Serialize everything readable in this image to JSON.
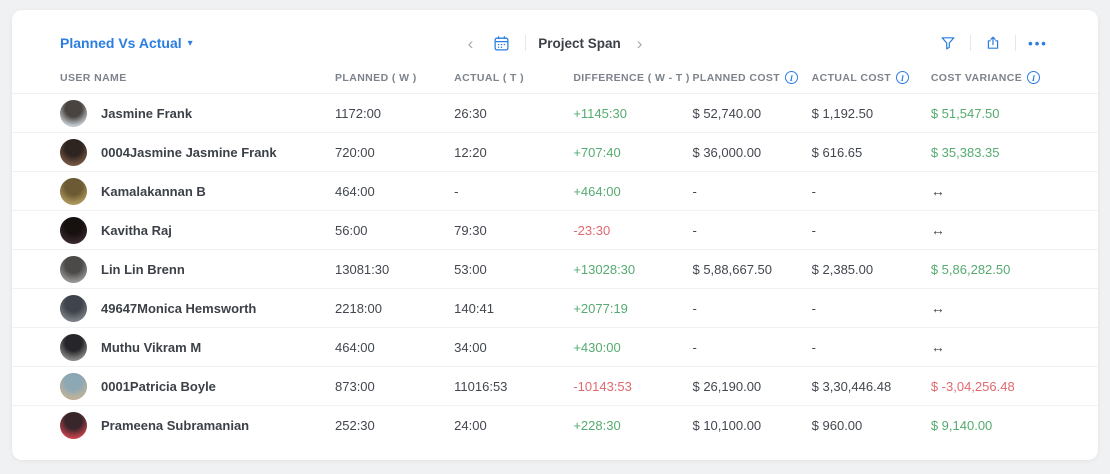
{
  "accent": {
    "blue": "#2b7de0",
    "green": "#55ab70",
    "red": "#e0696f",
    "card_bg": "#ffffff",
    "page_bg": "#f0f1f2"
  },
  "toolbar": {
    "view_selector_label": "Planned Vs Actual",
    "caret": "▾",
    "prev_glyph": "‹",
    "next_glyph": "›",
    "period_label": "Project Span",
    "more_glyph": "•••"
  },
  "table": {
    "columns": [
      {
        "label": "USER NAME",
        "info": false
      },
      {
        "label": "PLANNED ( W )",
        "info": false
      },
      {
        "label": "ACTUAL ( T )",
        "info": false
      },
      {
        "label": "DIFFERENCE ( W - T )",
        "info": false
      },
      {
        "label": "PLANNED COST",
        "info": true
      },
      {
        "label": "ACTUAL COST",
        "info": true
      },
      {
        "label": "COST VARIANCE",
        "info": true
      }
    ],
    "rows": [
      {
        "name": "Jasmine Frank",
        "planned": "1172:00",
        "actual": "26:30",
        "difference": "+1145:30",
        "difference_color": "green",
        "planned_cost": "$ 52,740.00",
        "actual_cost": "$ 1,192.50",
        "cost_variance": "$ 51,547.50",
        "variance_color": "green",
        "avatar": [
          "#cdd5dc",
          "#4a4440"
        ]
      },
      {
        "name": "0004Jasmine Jasmine Frank",
        "planned": "720:00",
        "actual": "12:20",
        "difference": "+707:40",
        "difference_color": "green",
        "planned_cost": "$ 36,000.00",
        "actual_cost": "$ 616.65",
        "cost_variance": "$ 35,383.35",
        "variance_color": "green",
        "avatar": [
          "#7a5a44",
          "#2e2420"
        ]
      },
      {
        "name": "Kamalakannan B",
        "planned": "464:00",
        "actual": "-",
        "difference": "+464:00",
        "difference_color": "green",
        "planned_cost": "-",
        "actual_cost": "-",
        "cost_variance": "↔",
        "variance_color": "neutral",
        "avatar": [
          "#b39c5e",
          "#6b5a33"
        ]
      },
      {
        "name": "Kavitha Raj",
        "planned": "56:00",
        "actual": "79:30",
        "difference": "-23:30",
        "difference_color": "red",
        "planned_cost": "-",
        "actual_cost": "-",
        "cost_variance": "↔",
        "variance_color": "neutral",
        "avatar": [
          "#3a2a30",
          "#16100f"
        ]
      },
      {
        "name": "Lin Lin Brenn",
        "planned": "13081:30",
        "actual": "53:00",
        "difference": "+13028:30",
        "difference_color": "green",
        "planned_cost": "$ 5,88,667.50",
        "actual_cost": "$ 2,385.00",
        "cost_variance": "$ 5,86,282.50",
        "variance_color": "green",
        "avatar": [
          "#9c9c9a",
          "#4c4a48"
        ]
      },
      {
        "name": "49647Monica Hemsworth",
        "planned": "2218:00",
        "actual": "140:41",
        "difference": "+2077:19",
        "difference_color": "green",
        "planned_cost": "-",
        "actual_cost": "-",
        "cost_variance": "↔",
        "variance_color": "neutral",
        "avatar": [
          "#80858c",
          "#3f444c"
        ]
      },
      {
        "name": "Muthu Vikram M",
        "planned": "464:00",
        "actual": "34:00",
        "difference": "+430:00",
        "difference_color": "green",
        "planned_cost": "-",
        "actual_cost": "-",
        "cost_variance": "↔",
        "variance_color": "neutral",
        "avatar": [
          "#8f8f8f",
          "#26262a"
        ]
      },
      {
        "name": "0001Patricia Boyle",
        "planned": "873:00",
        "actual": "11016:53",
        "difference": "-10143:53",
        "difference_color": "red",
        "planned_cost": "$ 26,190.00",
        "actual_cost": "$ 3,30,446.48",
        "cost_variance": "$ -3,04,256.48",
        "variance_color": "red",
        "avatar": [
          "#c6b496",
          "#8da8b5"
        ]
      },
      {
        "name": "Prameena Subramanian",
        "planned": "252:30",
        "actual": "24:00",
        "difference": "+228:30",
        "difference_color": "green",
        "planned_cost": "$ 10,100.00",
        "actual_cost": "$ 960.00",
        "cost_variance": "$ 9,140.00",
        "variance_color": "green",
        "avatar": [
          "#cf4450",
          "#38262a"
        ]
      }
    ]
  }
}
